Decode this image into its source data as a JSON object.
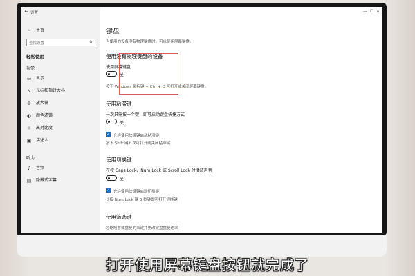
{
  "window": {
    "back_icon": "back-arrow-icon",
    "title": "设置"
  },
  "sidebar": {
    "home_label": "主页",
    "search_placeholder": "查找设置",
    "category_title": "轻松使用",
    "sections": [
      {
        "label": "视觉",
        "items": [
          {
            "label": "显示",
            "icon": "monitor-icon"
          },
          {
            "label": "光标和指针大小",
            "icon": "pointer-icon"
          },
          {
            "label": "放大镜",
            "icon": "magnifier-icon"
          },
          {
            "label": "颜色滤镜",
            "icon": "color-filter-icon"
          },
          {
            "label": "高对比度",
            "icon": "contrast-icon"
          },
          {
            "label": "讲述人",
            "icon": "narrator-icon"
          }
        ]
      },
      {
        "label": "听力",
        "items": [
          {
            "label": "音频",
            "icon": "speaker-icon"
          },
          {
            "label": "隐藏式字幕",
            "icon": "captions-icon"
          }
        ]
      }
    ]
  },
  "content": {
    "title": "键盘",
    "subtitle": "当使用的设备没有物理键盘时，可以使用屏幕键盘。",
    "sections": [
      {
        "heading": "使用没有物理键盘的设备",
        "toggle_label": "使用屏幕键盘",
        "toggle_state": "关",
        "hint": "按下 Windows 徽标键 + Ctrl + O 可打开或关闭屏幕键盘。"
      },
      {
        "heading": "使用粘滞键",
        "desc": "一次只需按一个键，即可启动键盘快捷方式",
        "toggle_state": "关",
        "checkbox_label": "允许使用快捷键启动粘滞键",
        "hint": "按下 Shift 键五次可打开或关闭粘滞键"
      },
      {
        "heading": "使用切换键",
        "desc": "在按 Caps Lock、Num Lock 或 Scroll Lock 时播放声音",
        "toggle_state": "关",
        "checkbox_label": "允许使用快捷键启动切换键",
        "hint": "长按 Num Lock 键 5 秒钟即可打开切换键"
      },
      {
        "heading": "使用筛选键",
        "desc": "忽略短暂或重复的击键并更改键盘重复速率"
      }
    ]
  },
  "caption": "打开使用屏幕键盘按钮就完成了",
  "colors": {
    "accent": "#1a73c7",
    "annotation": "#e05a5a"
  }
}
